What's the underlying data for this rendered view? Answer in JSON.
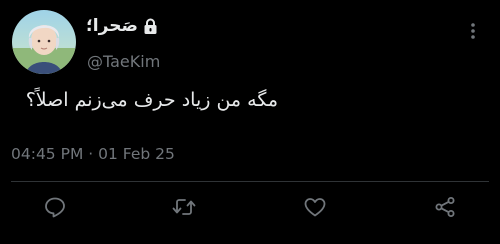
{
  "tweet": {
    "display_name": "صَحرا؛",
    "handle": "@TaeKim",
    "text": "مگه من زیاد حرف می‌زنم اصلاً؟",
    "timestamp": "04:45 PM · 01 Feb 25"
  },
  "icons": {
    "avatar": "profile-photo",
    "lock": "lock-icon",
    "more": "more-icon",
    "reply": "reply-icon",
    "retweet": "retweet-icon",
    "like": "like-icon",
    "share": "share-icon"
  },
  "colors": {
    "background": "#000000",
    "primary_text": "#e7e9ea",
    "secondary_text": "#71767b",
    "divider": "#2f3336"
  }
}
